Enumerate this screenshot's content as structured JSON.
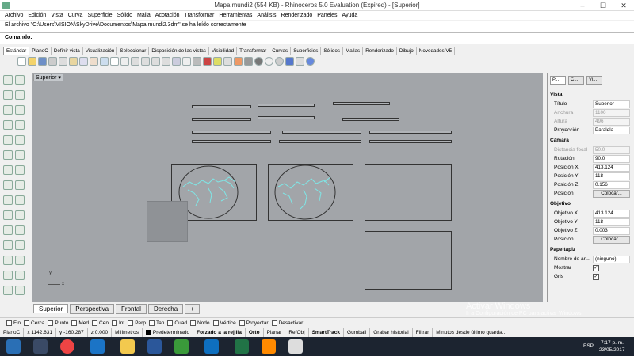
{
  "window": {
    "title": "Mapa mundi2 (554 KB) - Rhinoceros 5.0 Evaluation (Expired) - [Superior]",
    "min": "–",
    "max": "☐",
    "close": "✕"
  },
  "menu": [
    "Archivo",
    "Edición",
    "Vista",
    "Curva",
    "Superficie",
    "Sólido",
    "Malla",
    "Acotación",
    "Transformar",
    "Herramientas",
    "Análisis",
    "Renderizado",
    "Paneles",
    "Ayuda"
  ],
  "history": "El archivo \"C:\\Users\\VISION\\SkyDrive\\Documentos\\Mapa mundi2.3dm\" se ha leído correctamente",
  "command": {
    "label": "Comando:"
  },
  "toolbar_tabs": [
    "Estándar",
    "PlanoC",
    "Definir vista",
    "Visualización",
    "Seleccionar",
    "Disposición de las vistas",
    "Visibilidad",
    "Transformar",
    "Curvas",
    "Superficies",
    "Sólidos",
    "Mallas",
    "Renderizado",
    "Dibujo",
    "Novedades V5"
  ],
  "viewport": {
    "label": "Superior",
    "dropdown": "▾",
    "axis_y": "y",
    "axis_x": "x"
  },
  "view_tabs": [
    "Superior",
    "Perspectiva",
    "Frontal",
    "Derecha",
    "+"
  ],
  "panel": {
    "tabs": [
      "P...",
      "C...",
      "Vi..."
    ],
    "vista": "Vista",
    "rows_vista": [
      {
        "k": "Título",
        "v": "Superior",
        "dis": false
      },
      {
        "k": "Anchura",
        "v": "1100",
        "dis": true
      },
      {
        "k": "Altura",
        "v": "496",
        "dis": true
      },
      {
        "k": "Proyección",
        "v": "Paralela",
        "dis": false
      }
    ],
    "camara": "Cámara",
    "rows_camara": [
      {
        "k": "Distancia focal",
        "v": "50.0",
        "dis": true
      },
      {
        "k": "Rotación",
        "v": "90.0",
        "dis": false
      },
      {
        "k": "Posición X",
        "v": "413.124",
        "dis": false
      },
      {
        "k": "Posición Y",
        "v": "118",
        "dis": false
      },
      {
        "k": "Posición Z",
        "v": "0.156",
        "dis": false
      }
    ],
    "cam_pos_label": "Posición",
    "cam_pos_btn": "Colocar...",
    "objetivo": "Objetivo",
    "rows_objetivo": [
      {
        "k": "Objetivo X",
        "v": "413.124",
        "dis": false
      },
      {
        "k": "Objetivo Y",
        "v": "118",
        "dis": false
      },
      {
        "k": "Objetivo Z",
        "v": "0.003",
        "dis": false
      }
    ],
    "obj_pos_label": "Posición",
    "obj_pos_btn": "Colocar...",
    "papel": "Papeltapiz",
    "nombre_label": "Nombre de ar...",
    "nombre_value": "(ninguno)",
    "mostrar": "Mostrar",
    "gris": "Gris",
    "check": "✓"
  },
  "snaps": [
    "Fin",
    "Cerca",
    "Punto",
    "Med",
    "Cen",
    "Int",
    "Perp",
    "Tan",
    "Cuad",
    "Nodo",
    "Vértice",
    "Proyectar",
    "Desactivar"
  ],
  "status": [
    "PlanoC",
    "x 1142.631",
    "y -160.287",
    "z 0.000",
    "Milímetros",
    "Predeterminado",
    "Forzado a la rejilla",
    "Orto",
    "Planar",
    "RefObj",
    "SmartTrack",
    "Gumball",
    "Grabar historial",
    "Filtrar",
    "Minutos desde último guarda..."
  ],
  "watermark": {
    "line1": "Activar Windows",
    "line2": "Ir a Configuración de PC para activar Windows."
  },
  "clock": {
    "time": "7:17 p. m.",
    "date": "23/05/2017",
    "lang": "ESP"
  },
  "colors": {
    "map": "#7fe6e6",
    "viewport": "#a2a5a9"
  }
}
